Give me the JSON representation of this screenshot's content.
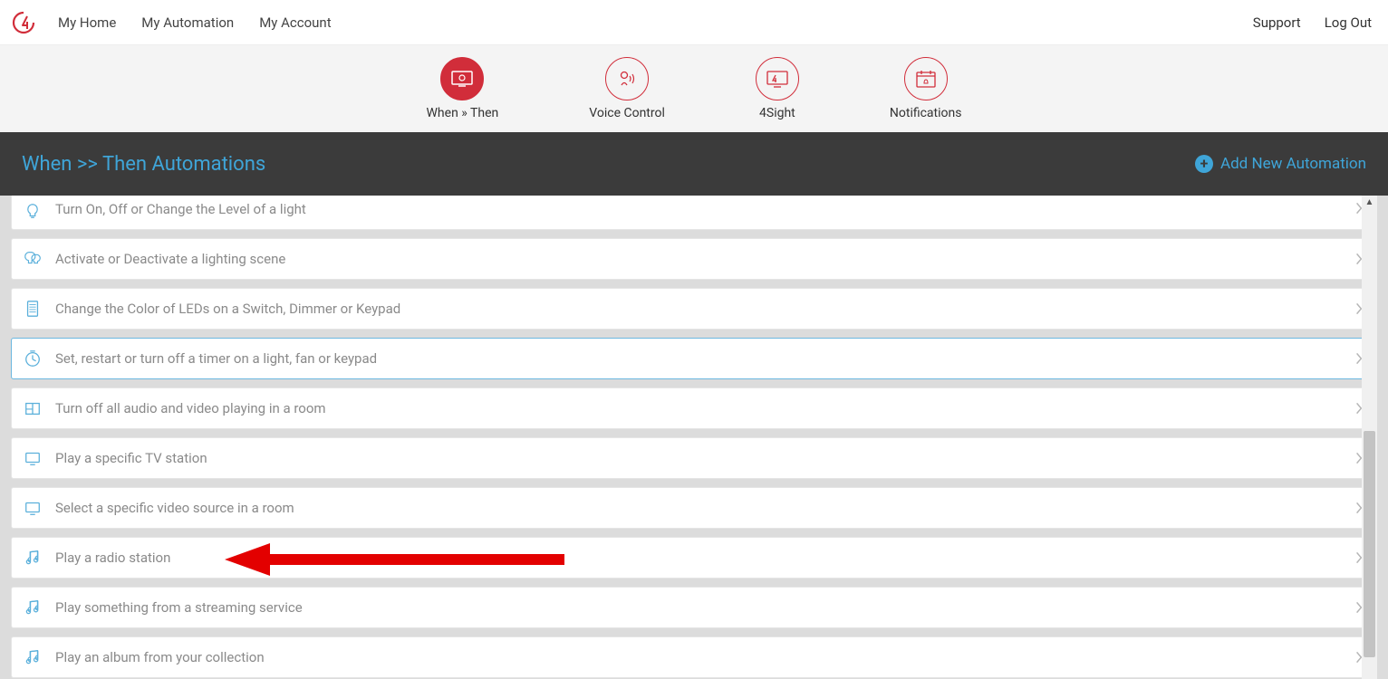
{
  "nav": {
    "left": [
      "My Home",
      "My Automation",
      "My Account"
    ],
    "right": [
      "Support",
      "Log Out"
    ]
  },
  "tabs": [
    {
      "label": "When » Then",
      "icon": "screen-icon",
      "active": true
    },
    {
      "label": "Voice Control",
      "icon": "voice-icon",
      "active": false
    },
    {
      "label": "4Sight",
      "icon": "sight-icon",
      "active": false
    },
    {
      "label": "Notifications",
      "icon": "calendar-bell-icon",
      "active": false
    }
  ],
  "section": {
    "title": "When >> Then Automations",
    "add_label": "Add New Automation"
  },
  "actions": [
    {
      "label": "Turn On, Off or Change the Level of a light",
      "icon": "bulb-icon",
      "cut": true
    },
    {
      "label": "Activate or Deactivate a lighting scene",
      "icon": "scene-icon"
    },
    {
      "label": "Change the Color of LEDs on a Switch, Dimmer or Keypad",
      "icon": "keypad-icon"
    },
    {
      "label": "Set, restart or turn off a timer on a light, fan or keypad",
      "icon": "timer-icon",
      "selected": true
    },
    {
      "label": "Turn off all audio and video playing in a room",
      "icon": "room-icon"
    },
    {
      "label": "Play a specific TV station",
      "icon": "tv-icon"
    },
    {
      "label": "Select a specific video source in a room",
      "icon": "tv-icon"
    },
    {
      "label": "Play a radio station",
      "icon": "music-icon",
      "arrow": true
    },
    {
      "label": "Play something from a streaming service",
      "icon": "music-icon"
    },
    {
      "label": "Play an album from your collection",
      "icon": "music-icon"
    }
  ],
  "colors": {
    "brand": "#d12d3a",
    "link": "#3fa5d8"
  }
}
